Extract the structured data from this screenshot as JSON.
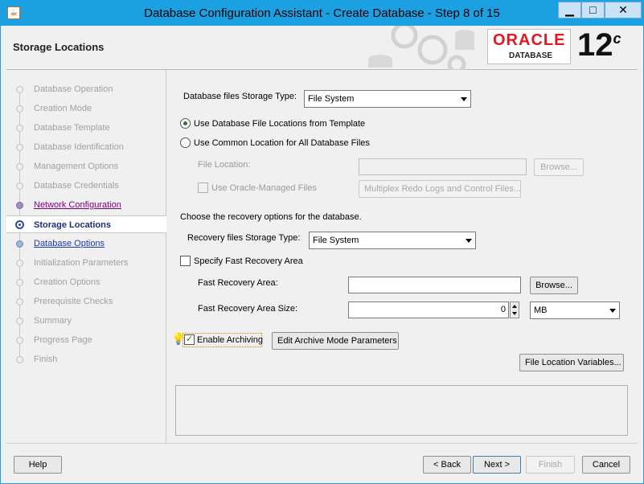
{
  "window": {
    "title": "Database Configuration Assistant - Create Database - Step 8 of 15",
    "app_icon": "java-cup-icon",
    "controls": {
      "minimize": "▁",
      "maximize": "□",
      "close": "✕"
    }
  },
  "header": {
    "page_title": "Storage Locations",
    "logo": {
      "brand": "ORACLE",
      "registered": "®",
      "product": "DATABASE",
      "version": "12",
      "version_suffix": "c"
    }
  },
  "nav": {
    "items": [
      {
        "label": "Database Operation",
        "state": "disabled"
      },
      {
        "label": "Creation Mode",
        "state": "disabled"
      },
      {
        "label": "Database Template",
        "state": "disabled"
      },
      {
        "label": "Database Identification",
        "state": "disabled"
      },
      {
        "label": "Management Options",
        "state": "disabled"
      },
      {
        "label": "Database Credentials",
        "state": "disabled"
      },
      {
        "label": "Network Configuration",
        "state": "visited"
      },
      {
        "label": "Storage Locations",
        "state": "current"
      },
      {
        "label": "Database Options",
        "state": "link"
      },
      {
        "label": "Initialization Parameters",
        "state": "disabled"
      },
      {
        "label": "Creation Options",
        "state": "disabled"
      },
      {
        "label": "Prerequisite Checks",
        "state": "disabled"
      },
      {
        "label": "Summary",
        "state": "disabled"
      },
      {
        "label": "Progress Page",
        "state": "disabled"
      },
      {
        "label": "Finish",
        "state": "disabled"
      }
    ]
  },
  "form": {
    "db_storage_type": {
      "label": "Database files Storage Type:",
      "value": "File System"
    },
    "radio_template": {
      "label": "Use Database File Locations from Template",
      "checked": true
    },
    "radio_common": {
      "label": "Use Common Location for All Database Files",
      "checked": false
    },
    "file_location": {
      "label": "File Location:",
      "value": "",
      "browse": "Browse..."
    },
    "oracle_managed": {
      "label": "Use Oracle-Managed Files",
      "checked": false
    },
    "multiplex_button": "Multiplex Redo Logs and Control Files...",
    "recovery_heading": "Choose the recovery options for the database.",
    "recovery_storage_type": {
      "label": "Recovery files Storage Type:",
      "value": "File System"
    },
    "fast_recovery_check": {
      "label": "Specify Fast Recovery Area",
      "checked": false
    },
    "fast_recovery_area": {
      "label": "Fast Recovery Area:",
      "value": "",
      "browse": "Browse..."
    },
    "fast_recovery_size": {
      "label": "Fast Recovery Area Size:",
      "value": "0",
      "unit": "MB"
    },
    "enable_archiving": {
      "label": "Enable Archiving",
      "checked": true
    },
    "edit_archive_button": "Edit Archive Mode Parameters",
    "file_location_vars_button": "File Location Variables..."
  },
  "footer": {
    "help": "Help",
    "back": "< Back",
    "next": "Next >",
    "finish": "Finish",
    "cancel": "Cancel"
  }
}
